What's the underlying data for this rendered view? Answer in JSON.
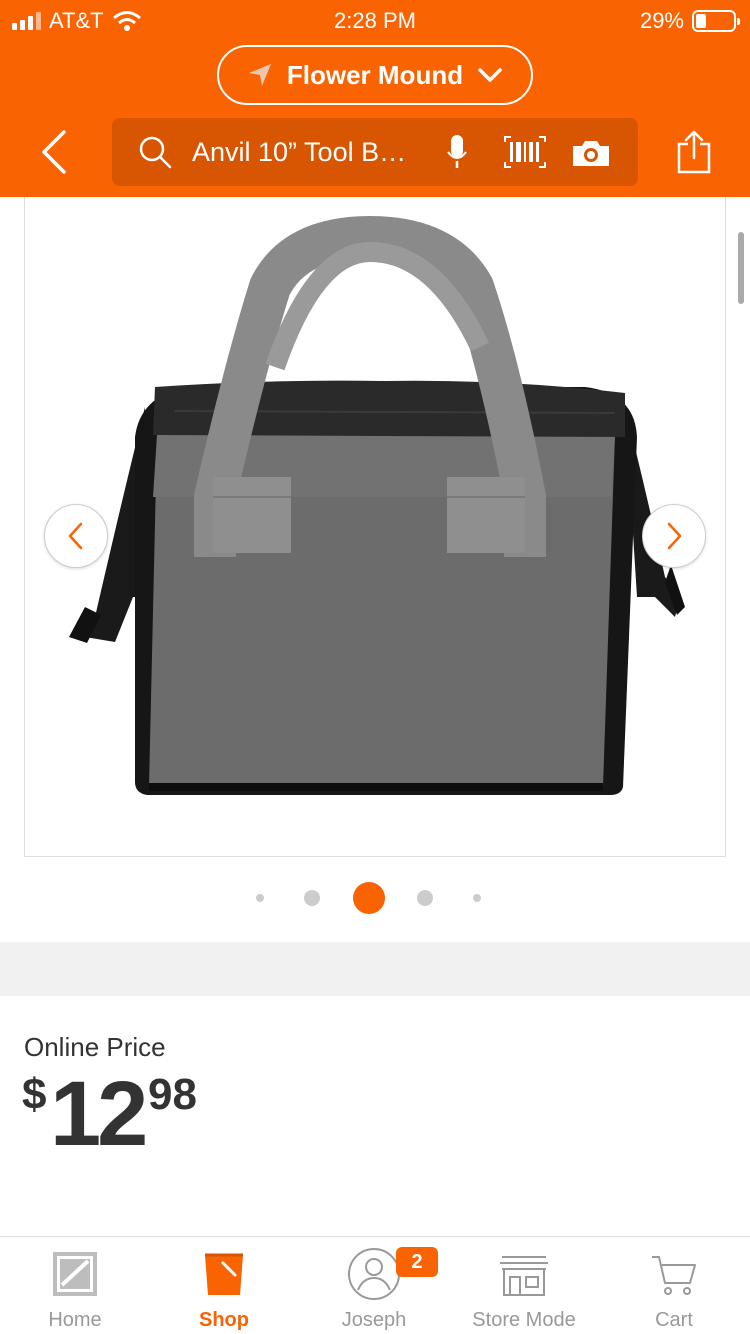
{
  "status_bar": {
    "carrier": "AT&T",
    "time": "2:28 PM",
    "battery_percent": "29%"
  },
  "header": {
    "store_name": "Flower Mound",
    "search_text": "Anvil 10” Tool B…",
    "brand_color": "#F96302",
    "icons": [
      "back-chevron-icon",
      "search-icon",
      "microphone-icon",
      "barcode-icon",
      "camera-icon",
      "share-icon"
    ]
  },
  "gallery": {
    "image_count": 5,
    "active_index": 2,
    "image": "gray-black-tool-bag-with-gray-handles",
    "accent_color": "#F96302"
  },
  "price": {
    "label": "Online Price",
    "currency": "$",
    "dollars": "12",
    "cents": "98"
  },
  "tab_bar": {
    "items": [
      {
        "label": "Home",
        "icon": "home-depot-logo-icon",
        "active": false
      },
      {
        "label": "Shop",
        "icon": "bucket-icon",
        "active": true
      },
      {
        "label": "Joseph",
        "icon": "user-icon",
        "active": false,
        "badge": "2"
      },
      {
        "label": "Store Mode",
        "icon": "store-icon",
        "active": false
      },
      {
        "label": "Cart",
        "icon": "cart-icon",
        "active": false
      }
    ]
  }
}
